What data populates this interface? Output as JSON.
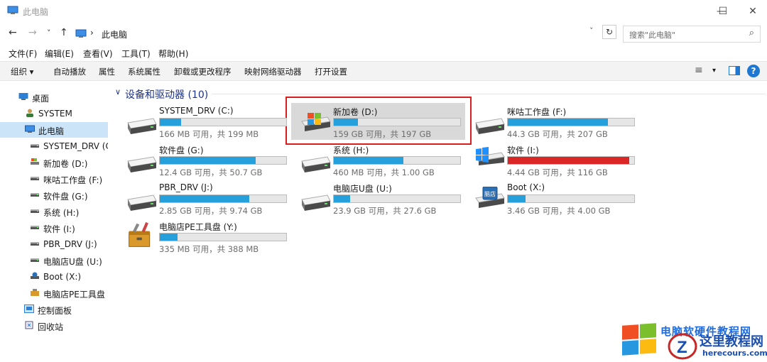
{
  "window": {
    "title": "此电脑",
    "minimize": "—",
    "maximize": "☐",
    "close": "✕"
  },
  "address": {
    "back": "←",
    "forward": "→",
    "recent": "˅",
    "up": "↑",
    "separator": "›",
    "path": "此电脑",
    "dropdown": "˅",
    "refresh": "↻",
    "search_placeholder": "搜索\"此电脑\"",
    "search_icon": "⌕"
  },
  "menu": [
    "文件(F)",
    "编辑(E)",
    "查看(V)",
    "工具(T)",
    "帮助(H)"
  ],
  "commands": {
    "organize": "组织 ▾",
    "autoplay": "自动播放",
    "properties": "属性",
    "system_properties": "系统属性",
    "uninstall": "卸载或更改程序",
    "map_drive": "映射网络驱动器",
    "open_settings": "打开设置",
    "view_icon": "≡",
    "view_drop": "▾",
    "pane_icon": "▯",
    "help": "?"
  },
  "nav": [
    {
      "label": "桌面",
      "icon": "desktop-icon"
    },
    {
      "label": "SYSTEM",
      "icon": "user-icon"
    },
    {
      "label": "此电脑",
      "icon": "computer-icon",
      "selected": true
    },
    {
      "label": "SYSTEM_DRV (C:",
      "icon": "drive-icon"
    },
    {
      "label": "新加卷 (D:)",
      "icon": "windows-drive-icon"
    },
    {
      "label": "咪咕工作盘 (F:)",
      "icon": "drive-icon"
    },
    {
      "label": "软件盘 (G:)",
      "icon": "drive-icon"
    },
    {
      "label": "系统 (H:)",
      "icon": "drive-icon"
    },
    {
      "label": "软件 (I:)",
      "icon": "drive-icon"
    },
    {
      "label": "PBR_DRV (J:)",
      "icon": "drive-icon"
    },
    {
      "label": "电脑店U盘 (U:)",
      "icon": "drive-icon"
    },
    {
      "label": "Boot (X:)",
      "icon": "boot-drive-icon"
    },
    {
      "label": "电脑店PE工具盘 (",
      "icon": "toolbox-icon"
    },
    {
      "label": "控制面板",
      "icon": "control-panel-icon"
    },
    {
      "label": "回收站",
      "icon": "recycle-bin-icon"
    }
  ],
  "group": {
    "chevron": "∨",
    "title": "设备和驱动器 (10)"
  },
  "drives": [
    {
      "name": "SYSTEM_DRV (C:)",
      "free": "166 MB 可用，共 199 MB",
      "used_fraction": 0.17,
      "icon": "hdd-icon"
    },
    {
      "name": "新加卷 (D:)",
      "free": "159 GB 可用，共 197 GB",
      "used_fraction": 0.19,
      "icon": "windows-drive-icon",
      "selected": true
    },
    {
      "name": "咪咕工作盘 (F:)",
      "free": "44.3 GB 可用，共 207 GB",
      "used_fraction": 0.79,
      "icon": "hdd-icon"
    },
    {
      "name": "软件盘 (G:)",
      "free": "12.4 GB 可用，共 50.7 GB",
      "used_fraction": 0.76,
      "icon": "hdd-icon"
    },
    {
      "name": "系统 (H:)",
      "free": "460 MB 可用，共 1.00 GB",
      "used_fraction": 0.55,
      "icon": "hdd-icon"
    },
    {
      "name": "软件 (I:)",
      "free": "4.44 GB 可用，共 116 GB",
      "used_fraction": 0.96,
      "icon": "windows10-drive-icon",
      "critical": true
    },
    {
      "name": "PBR_DRV (J:)",
      "free": "2.85 GB 可用，共 9.74 GB",
      "used_fraction": 0.71,
      "icon": "hdd-icon"
    },
    {
      "name": "电脑店U盘 (U:)",
      "free": "23.9 GB 可用，共 27.6 GB",
      "used_fraction": 0.13,
      "icon": "hdd-icon"
    },
    {
      "name": "Boot (X:)",
      "free": "3.46 GB 可用，共 4.00 GB",
      "used_fraction": 0.14,
      "icon": "boot-drive-icon"
    },
    {
      "name": "电脑店PE工具盘 (Y:)",
      "free": "335 MB 可用，共 388 MB",
      "used_fraction": 0.14,
      "icon": "toolbox-icon"
    }
  ],
  "watermark": {
    "title": "电脑软硬件教程网",
    "main": "这里教程网",
    "sub": "herecours.com"
  }
}
